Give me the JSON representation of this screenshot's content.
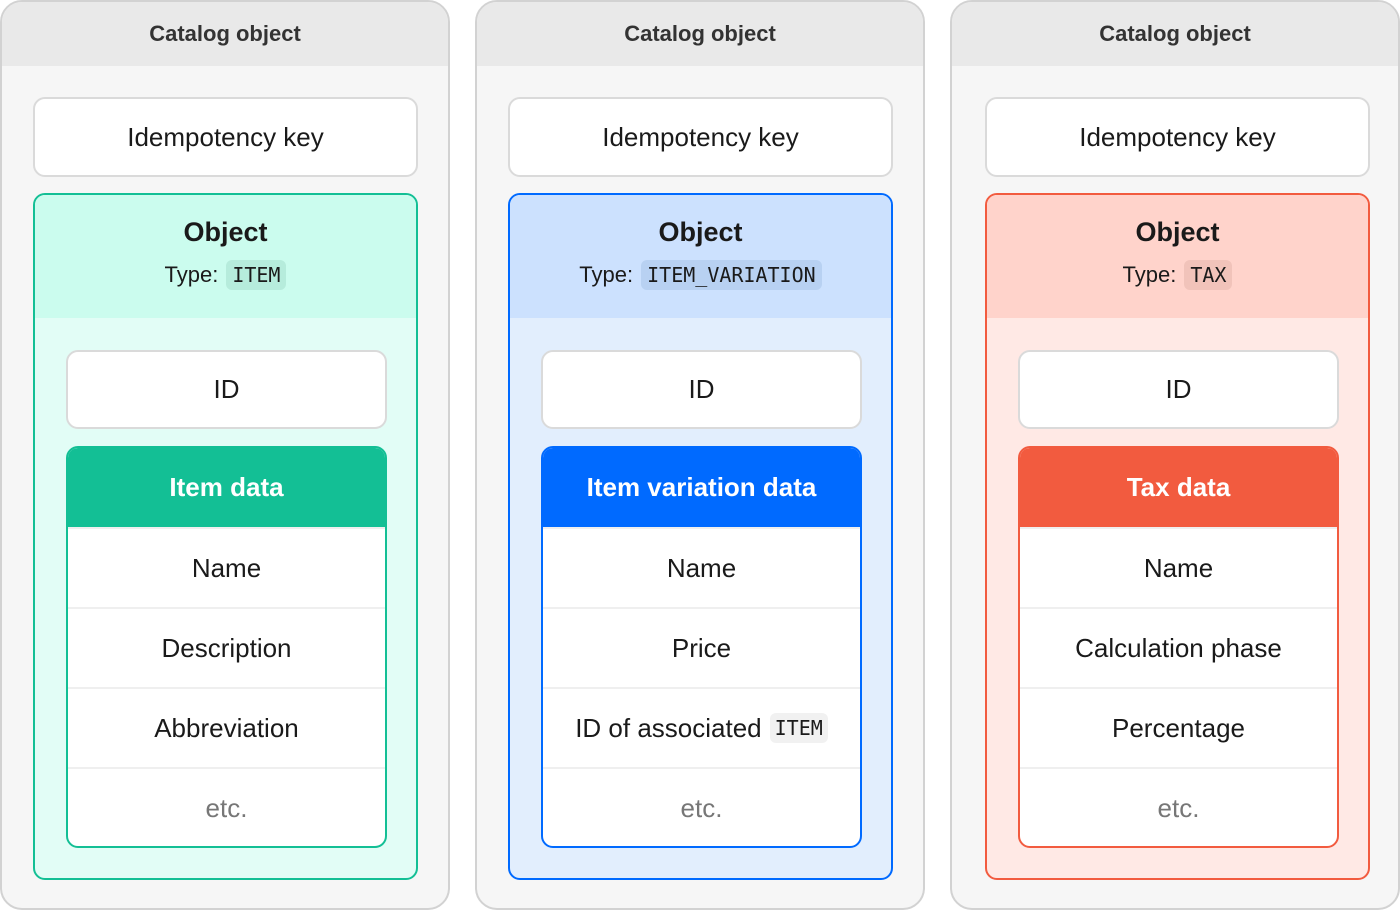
{
  "cards": [
    {
      "header": "Catalog object",
      "idempotency_label": "Idempotency key",
      "object_title": "Object",
      "type_label": "Type:",
      "type_value": "ITEM",
      "id_label": "ID",
      "data_title": "Item data",
      "fields": [
        "Name",
        "Description",
        "Abbreviation"
      ],
      "etc_label": "etc.",
      "colors": {
        "accent": "#13bf95",
        "head_bg": "#cbfcee",
        "body_bg": "#e2fdf6",
        "code_bg": "#b6ecdc"
      }
    },
    {
      "header": "Catalog object",
      "idempotency_label": "Idempotency key",
      "object_title": "Object",
      "type_label": "Type:",
      "type_value": "ITEM_VARIATION",
      "id_label": "ID",
      "data_title": "Item variation data",
      "fields": [
        "Name",
        "Price"
      ],
      "associated_field": {
        "label": "ID of associated",
        "code": "ITEM"
      },
      "etc_label": "etc.",
      "colors": {
        "accent": "#006aff",
        "head_bg": "#cce1fe",
        "body_bg": "#e2eefd",
        "code_bg": "#b8d1f2"
      }
    },
    {
      "header": "Catalog object",
      "idempotency_label": "Idempotency key",
      "object_title": "Object",
      "type_label": "Type:",
      "type_value": "TAX",
      "id_label": "ID",
      "data_title": "Tax data",
      "fields": [
        "Name",
        "Calculation phase",
        "Percentage"
      ],
      "etc_label": "etc.",
      "colors": {
        "accent": "#f25b3f",
        "head_bg": "#ffd3cb",
        "body_bg": "#ffe9e5",
        "code_bg": "#f1c3ba"
      }
    }
  ]
}
